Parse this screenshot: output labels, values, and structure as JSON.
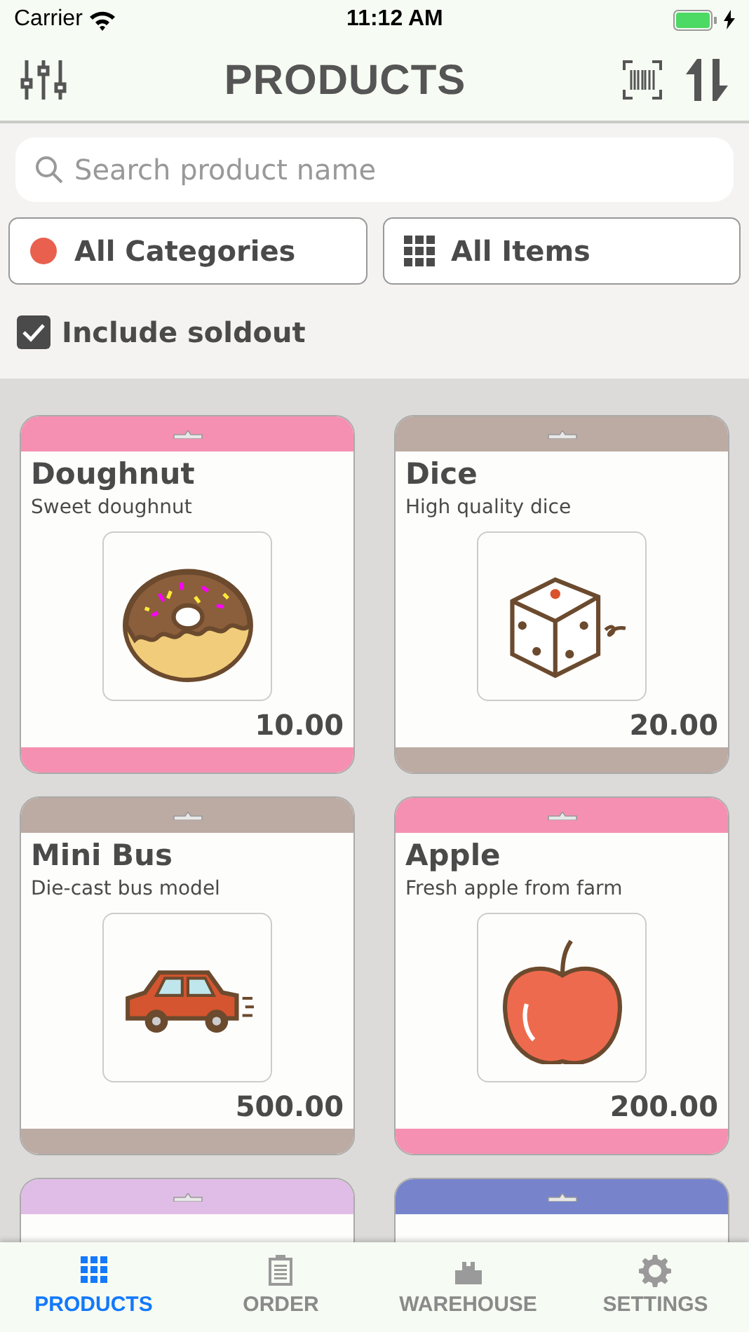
{
  "status_bar": {
    "carrier": "Carrier",
    "time": "11:12 AM"
  },
  "navbar": {
    "title": "PRODUCTS"
  },
  "search": {
    "placeholder": "Search product name"
  },
  "filters": [
    {
      "label": "All Categories",
      "kind": "category"
    },
    {
      "label": "All Items",
      "kind": "items"
    }
  ],
  "include_soldout": {
    "label": "Include soldout",
    "checked": true
  },
  "products": [
    {
      "name": "Doughnut",
      "description": "Sweet doughnut",
      "price": "10.00",
      "color": "#f590b2"
    },
    {
      "name": "Dice",
      "description": "High quality dice",
      "price": "20.00",
      "color": "#bcaba3"
    },
    {
      "name": "Mini Bus",
      "description": "Die-cast bus model",
      "price": "500.00",
      "color": "#bcaba3"
    },
    {
      "name": "Apple",
      "description": "Fresh apple from farm",
      "price": "200.00",
      "color": "#f590b2"
    },
    {
      "color": "#e0bde6"
    },
    {
      "color": "#7784cb"
    }
  ],
  "tabs": [
    {
      "label": "PRODUCTS",
      "selected": true
    },
    {
      "label": "ORDER",
      "selected": false
    },
    {
      "label": "WAREHOUSE",
      "selected": false
    },
    {
      "label": "SETTINGS",
      "selected": false
    }
  ]
}
